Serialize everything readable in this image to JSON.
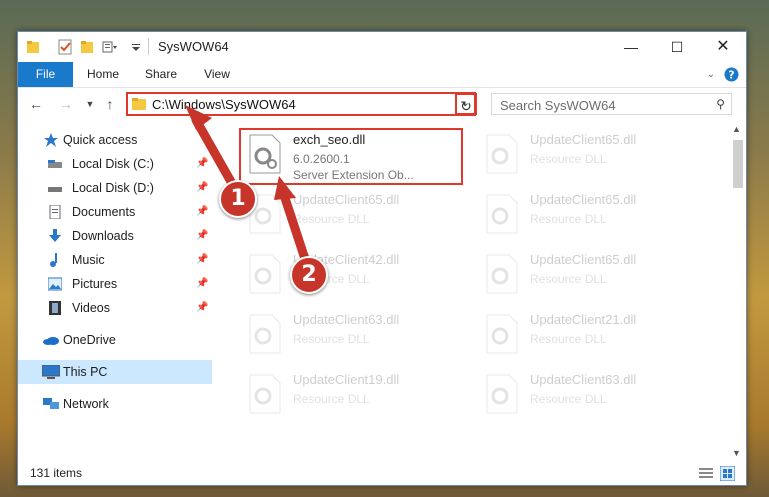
{
  "window": {
    "title": "SysWOW64"
  },
  "ribbon": {
    "tabs": [
      "File",
      "Home",
      "Share",
      "View"
    ]
  },
  "address": {
    "path": "C:\\Windows\\SysWOW64"
  },
  "search": {
    "placeholder": "Search SysWOW64"
  },
  "sidebar": {
    "items": [
      {
        "label": "Quick access",
        "pinned": false
      },
      {
        "label": "Local Disk (C:)",
        "pinned": true
      },
      {
        "label": "Local Disk (D:)",
        "pinned": true
      },
      {
        "label": "Documents",
        "pinned": true
      },
      {
        "label": "Downloads",
        "pinned": true
      },
      {
        "label": "Music",
        "pinned": true
      },
      {
        "label": "Pictures",
        "pinned": true
      },
      {
        "label": "Videos",
        "pinned": true
      },
      {
        "label": "OneDrive",
        "pinned": false
      },
      {
        "label": "This PC",
        "pinned": false,
        "selected": true
      },
      {
        "label": "Network",
        "pinned": false
      }
    ]
  },
  "files": [
    {
      "name": "exch_seo.dll",
      "version": "6.0.2600.1",
      "description": "Server Extension Ob..."
    },
    {
      "name": "UpdateClient65.dll",
      "description": "Resource DLL"
    },
    {
      "name": "UpdateClient65.dll",
      "description": "Resource DLL"
    },
    {
      "name": "UpdateClient65.dll",
      "description": "Resource DLL"
    },
    {
      "name": "UpdateClient42.dll",
      "description": "Resource DLL"
    },
    {
      "name": "UpdateClient65.dll",
      "description": "Resource DLL"
    },
    {
      "name": "UpdateClient63.dll",
      "description": "Resource DLL"
    },
    {
      "name": "UpdateClient21.dll",
      "description": "Resource DLL"
    },
    {
      "name": "UpdateClient19.dll",
      "description": "Resource DLL"
    },
    {
      "name": "UpdateClient63.dll",
      "description": "Resource DLL"
    }
  ],
  "status": {
    "item_count": "131 items"
  },
  "callouts": [
    "1",
    "2"
  ],
  "colors": {
    "accent": "#1979ca",
    "highlight": "#e0392b",
    "selection": "#cce8ff"
  }
}
